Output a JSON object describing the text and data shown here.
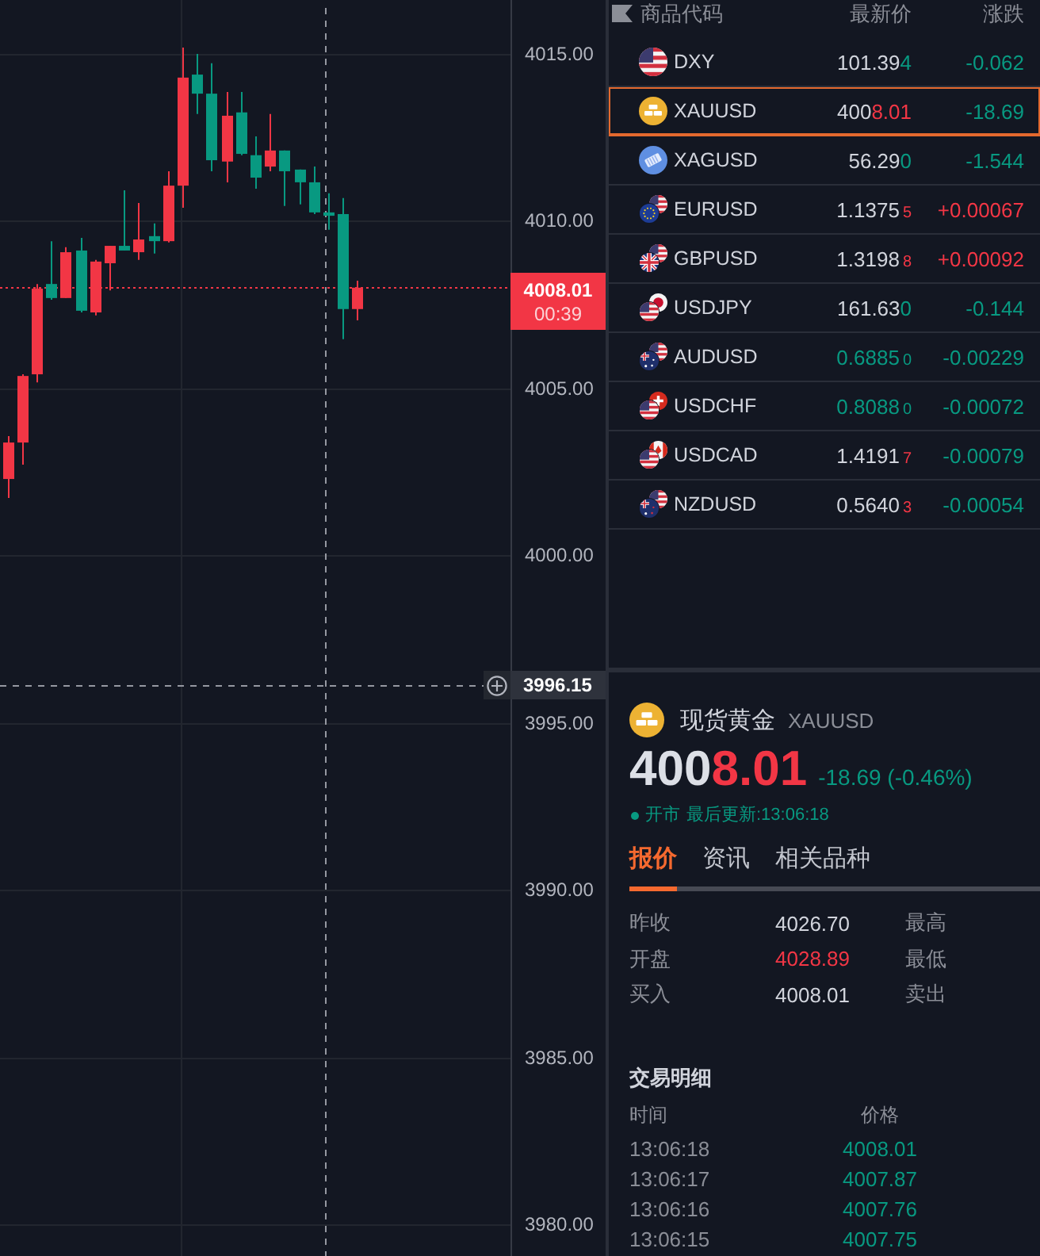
{
  "chart": {
    "chart_data": {
      "type": "candlestick",
      "grid": true,
      "categories": [
        null,
        null,
        null,
        null,
        null,
        null,
        null,
        null,
        null,
        null,
        null,
        null,
        null,
        null,
        null,
        null,
        null,
        null,
        null,
        null,
        null,
        null,
        null,
        null,
        null,
        null,
        null,
        null,
        null,
        null,
        null,
        null,
        null,
        null,
        null
      ],
      "ohlc": [
        [
          4002.29,
          4003.57,
          4001.72,
          4003.38
        ],
        [
          4003.38,
          4005.42,
          4002.72,
          4005.37
        ],
        [
          4005.42,
          4008.12,
          4005.18,
          4007.98
        ],
        [
          4008.12,
          4009.4,
          4007.65,
          4007.7
        ],
        [
          4007.7,
          4009.22,
          4007.7,
          4009.07
        ],
        [
          4009.12,
          4009.5,
          4007.27,
          4007.32
        ],
        [
          4007.27,
          4008.84,
          4007.18,
          4008.79
        ],
        [
          4008.74,
          4009.26,
          4007.93,
          4009.26
        ],
        [
          4009.26,
          4010.92,
          4009.12,
          4009.12
        ],
        [
          4009.07,
          4010.54,
          4008.84,
          4009.45
        ],
        [
          4009.55,
          4009.93,
          4009.03,
          4009.4
        ],
        [
          4009.4,
          4011.49,
          4009.36,
          4011.06
        ],
        [
          4011.06,
          4015.19,
          4010.4,
          4014.29
        ],
        [
          4014.38,
          4015.0,
          4013.2,
          4013.81
        ],
        [
          4013.81,
          4014.72,
          4011.49,
          4011.82
        ],
        [
          4011.78,
          4013.86,
          4011.16,
          4013.15
        ],
        [
          4013.25,
          4013.86,
          4011.97,
          4012.01
        ],
        [
          4011.97,
          4012.53,
          4010.97,
          4011.3
        ],
        [
          4011.63,
          4013.2,
          4011.49,
          4012.11
        ],
        [
          4012.11,
          4012.11,
          4010.45,
          4011.49
        ],
        [
          4011.54,
          4011.54,
          4010.5,
          4011.16
        ],
        [
          4011.16,
          4011.63,
          4010.21,
          4010.26
        ],
        [
          4010.26,
          4010.83,
          4009.74,
          4010.16
        ],
        [
          4010.21,
          4010.69,
          4006.47,
          4007.37
        ],
        [
          4007.37,
          4008.22,
          4007.03,
          4008.01
        ],
        null,
        null,
        null,
        null,
        null,
        null,
        null,
        null,
        null,
        null
      ],
      "ylim": [
        3979.06,
        4016.61
      ],
      "yticks": [
        {
          "value": 4015,
          "label": "4015.00"
        },
        {
          "value": 4010,
          "label": "4010.00"
        },
        {
          "value": 4005,
          "label": "4005.00"
        },
        {
          "value": 4000,
          "label": "4000.00"
        },
        {
          "value": 3995,
          "label": "3995.00"
        },
        {
          "value": 3990,
          "label": "3990.00"
        },
        {
          "value": 3985,
          "label": "3985.00"
        },
        {
          "value": 3980,
          "label": "3980.00"
        }
      ],
      "ref_lines": [
        {
          "axis": "y",
          "value": 4008.01,
          "label": "4008.01",
          "color": "#f23645"
        },
        {
          "axis": "y",
          "value": 3996.15,
          "label": "3996.15",
          "color": "#9598a1"
        }
      ]
    },
    "countdown": "00:39"
  },
  "watchlist": {
    "columns": [
      "商品代码",
      "最新价",
      "涨跌"
    ],
    "rows": [
      {
        "symbol": "DXY",
        "price_parts": [
          {
            "text": "101.39",
            "color": "#d1d4dc",
            "small": false
          },
          {
            "text": "4",
            "color": "#089981",
            "small": false
          }
        ],
        "change": {
          "text": "-0.062",
          "color": "#089981"
        },
        "selected": false
      },
      {
        "symbol": "XAUUSD",
        "price_parts": [
          {
            "text": "400",
            "color": "#d1d4dc",
            "small": false
          },
          {
            "text": "8.01",
            "color": "#f23645",
            "small": false
          }
        ],
        "change": {
          "text": "-18.69",
          "color": "#089981"
        },
        "selected": true
      },
      {
        "symbol": "XAGUSD",
        "price_parts": [
          {
            "text": "56.29",
            "color": "#d1d4dc",
            "small": false
          },
          {
            "text": "0",
            "color": "#089981",
            "small": false
          }
        ],
        "change": {
          "text": "-1.544",
          "color": "#089981"
        },
        "selected": false
      },
      {
        "symbol": "EURUSD",
        "price_parts": [
          {
            "text": "1.1375",
            "color": "#d1d4dc",
            "small": false
          },
          {
            "text": "5",
            "color": "#f23645",
            "small": true
          }
        ],
        "change": {
          "text": "+0.00067",
          "color": "#f23645"
        },
        "selected": false
      },
      {
        "symbol": "GBPUSD",
        "price_parts": [
          {
            "text": "1.3198",
            "color": "#d1d4dc",
            "small": false
          },
          {
            "text": "8",
            "color": "#f23645",
            "small": true
          }
        ],
        "change": {
          "text": "+0.00092",
          "color": "#f23645"
        },
        "selected": false
      },
      {
        "symbol": "USDJPY",
        "price_parts": [
          {
            "text": "161.63",
            "color": "#d1d4dc",
            "small": false
          },
          {
            "text": "0",
            "color": "#089981",
            "small": false
          }
        ],
        "change": {
          "text": "-0.144",
          "color": "#089981"
        },
        "selected": false
      },
      {
        "symbol": "AUDUSD",
        "price_parts": [
          {
            "text": "0.6885",
            "color": "#089981",
            "small": false
          },
          {
            "text": "0",
            "color": "#089981",
            "small": true
          }
        ],
        "change": {
          "text": "-0.00229",
          "color": "#089981"
        },
        "selected": false
      },
      {
        "symbol": "USDCHF",
        "price_parts": [
          {
            "text": "0.8088",
            "color": "#089981",
            "small": false
          },
          {
            "text": "0",
            "color": "#089981",
            "small": true
          }
        ],
        "change": {
          "text": "-0.00072",
          "color": "#089981"
        },
        "selected": false
      },
      {
        "symbol": "USDCAD",
        "price_parts": [
          {
            "text": "1.4191",
            "color": "#d1d4dc",
            "small": false
          },
          {
            "text": "7",
            "color": "#f23645",
            "small": true
          }
        ],
        "change": {
          "text": "-0.00079",
          "color": "#089981"
        },
        "selected": false
      },
      {
        "symbol": "NZDUSD",
        "price_parts": [
          {
            "text": "0.5640",
            "color": "#d1d4dc",
            "small": false
          },
          {
            "text": "3",
            "color": "#f23645",
            "small": true
          }
        ],
        "change": {
          "text": "-0.00054",
          "color": "#089981"
        },
        "selected": false
      }
    ]
  },
  "quote": {
    "name": "现货黄金",
    "symbol": "XAUUSD",
    "price_parts": [
      {
        "text": "400",
        "color": "#dcdfe6"
      },
      {
        "text": "8.01",
        "color": "#f23645"
      }
    ],
    "change": {
      "text": "-18.69 (-0.46%)",
      "color": "#089981"
    },
    "market_open": true,
    "market_status": "开市",
    "last_update": "最后更新:13:06:18",
    "tabs": [
      {
        "label": "报价",
        "selected": true
      },
      {
        "label": "资讯",
        "selected": false
      },
      {
        "label": "相关品种",
        "selected": false
      }
    ],
    "stats": [
      {
        "label": "昨收",
        "value": {
          "text": "4026.70",
          "color": "#d1d4dc"
        },
        "side_label": "最高"
      },
      {
        "label": "开盘",
        "value": {
          "text": "4028.89",
          "color": "#f23645"
        },
        "side_label": "最低"
      },
      {
        "label": "买入",
        "value": {
          "text": "4008.01",
          "color": "#d1d4dc"
        },
        "side_label": "卖出"
      }
    ]
  },
  "trades": {
    "title": "交易明细",
    "columns": [
      "时间",
      "价格"
    ],
    "rows": [
      {
        "time": "13:06:18",
        "price": {
          "text": "4008.01",
          "color": "#089981"
        }
      },
      {
        "time": "13:06:17",
        "price": {
          "text": "4007.87",
          "color": "#089981"
        }
      },
      {
        "time": "13:06:16",
        "price": {
          "text": "4007.76",
          "color": "#089981"
        }
      },
      {
        "time": "13:06:15",
        "price": {
          "text": "4007.75",
          "color": "#089981"
        }
      }
    ]
  }
}
